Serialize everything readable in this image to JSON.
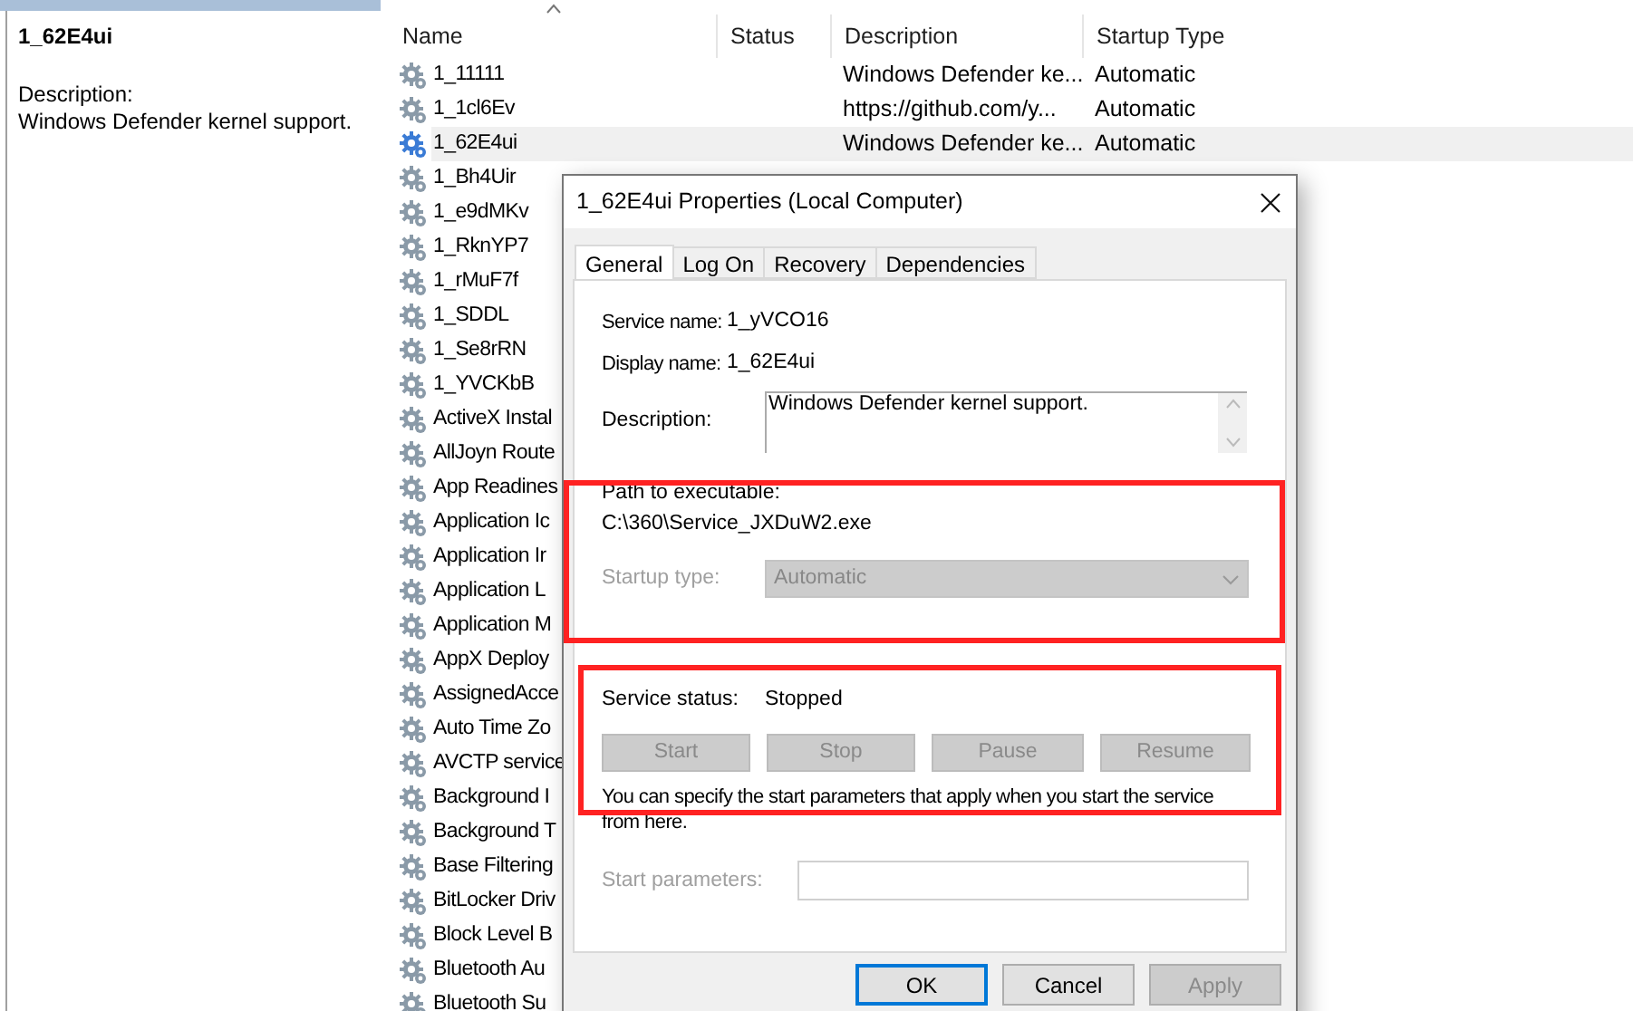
{
  "details": {
    "title": "1_62E4ui",
    "description_label": "Description:",
    "description": "Windows Defender kernel support."
  },
  "columns": [
    "Name",
    "Status",
    "Description",
    "Startup Type"
  ],
  "rows": [
    {
      "name": "1_11111",
      "description": "Windows Defender ke...",
      "startup_type": "Automatic",
      "selected": false
    },
    {
      "name": "1_1cl6Ev",
      "description": "https://github.com/y...",
      "startup_type": "Automatic",
      "selected": false
    },
    {
      "name": "1_62E4ui",
      "description": "Windows Defender ke...",
      "startup_type": "Automatic",
      "selected": true
    },
    {
      "name": "1_Bh4Uir",
      "selected": false
    },
    {
      "name": "1_e9dMKv",
      "selected": false
    },
    {
      "name": "1_RknYP7",
      "selected": false
    },
    {
      "name": "1_rMuF7f",
      "selected": false
    },
    {
      "name": "1_SDDL",
      "selected": false
    },
    {
      "name": "1_Se8rRN",
      "selected": false
    },
    {
      "name": "1_YVCKbB",
      "selected": false
    },
    {
      "name": "ActiveX Instal",
      "selected": false
    },
    {
      "name": "AllJoyn Route",
      "selected": false
    },
    {
      "name": "App Readines",
      "selected": false
    },
    {
      "name": "Application Ic",
      "selected": false
    },
    {
      "name": "Application Ir",
      "selected": false
    },
    {
      "name": "Application L",
      "selected": false
    },
    {
      "name": "Application M",
      "selected": false
    },
    {
      "name": "AppX Deploy",
      "selected": false
    },
    {
      "name": "AssignedAcce",
      "selected": false
    },
    {
      "name": "Auto Time Zo",
      "selected": false
    },
    {
      "name": "AVCTP service",
      "selected": false
    },
    {
      "name": "Background I",
      "selected": false
    },
    {
      "name": "Background T",
      "selected": false
    },
    {
      "name": "Base Filtering",
      "selected": false
    },
    {
      "name": "BitLocker Driv",
      "selected": false
    },
    {
      "name": "Block Level B",
      "selected": false
    },
    {
      "name": "Bluetooth Au",
      "selected": false
    },
    {
      "name": "Bluetooth Su",
      "selected": false
    }
  ],
  "dialog": {
    "title": "1_62E4ui Properties (Local Computer)",
    "tabs": [
      {
        "label": "General",
        "selected": true
      },
      {
        "label": "Log On",
        "selected": false
      },
      {
        "label": "Recovery",
        "selected": false
      },
      {
        "label": "Dependencies",
        "selected": false
      }
    ],
    "service_name_label": "Service name:",
    "service_name": "1_yVCO16",
    "display_name_label": "Display name:",
    "display_name": "1_62E4ui",
    "description_label": "Description:",
    "description": "Windows Defender kernel support.",
    "path_label": "Path to executable:",
    "path": "C:\\360\\Service_JXDuW2.exe",
    "startup_type_label": "Startup type:",
    "startup_type": "Automatic",
    "startup_type_disabled": true,
    "service_status_label": "Service status:",
    "service_status": "Stopped",
    "service_buttons": [
      {
        "label": "Start",
        "disabled": true
      },
      {
        "label": "Stop",
        "disabled": true
      },
      {
        "label": "Pause",
        "disabled": true
      },
      {
        "label": "Resume",
        "disabled": true
      }
    ],
    "hint": "You can specify the start parameters that apply when you start the service from here.",
    "start_parameters_label": "Start parameters:",
    "start_parameters_disabled": true,
    "buttons": [
      {
        "label": "OK",
        "default": true,
        "disabled": false
      },
      {
        "label": "Cancel",
        "default": false,
        "disabled": false
      },
      {
        "label": "Apply",
        "default": false,
        "disabled": true
      }
    ]
  }
}
